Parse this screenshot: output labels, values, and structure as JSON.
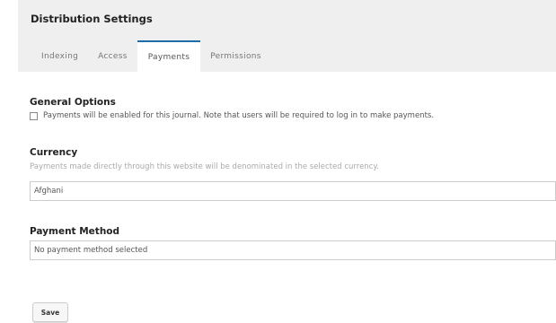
{
  "panel": {
    "title": "Distribution Settings"
  },
  "tabs": [
    {
      "label": "Indexing"
    },
    {
      "label": "Access"
    },
    {
      "label": "Payments"
    },
    {
      "label": "Permissions"
    }
  ],
  "general": {
    "title": "General Options",
    "checkbox_label": "Payments will be enabled for this journal. Note that users will be required to log in to make payments.",
    "checked": false
  },
  "currency": {
    "title": "Currency",
    "description": "Payments made directly through this website will be denominated in the selected currency.",
    "selected": "Afghani"
  },
  "payment_method": {
    "title": "Payment Method",
    "selected": "No payment method selected"
  },
  "actions": {
    "save_label": "Save"
  },
  "colors": {
    "active_tab_border": "#1e6fa8",
    "panel_bg": "#efefef"
  }
}
